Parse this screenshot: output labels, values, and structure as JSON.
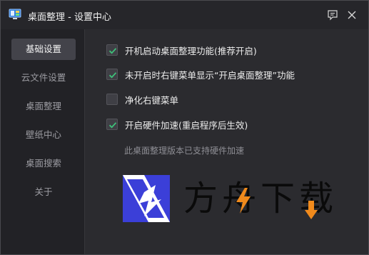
{
  "window": {
    "title": "桌面整理 - 设置中心",
    "icons": {
      "app": "monitor-icon",
      "feedback": "feedback-icon",
      "close": "close-icon"
    }
  },
  "sidebar": {
    "items": [
      {
        "label": "基础设置",
        "active": true
      },
      {
        "label": "云文件设置",
        "active": false
      },
      {
        "label": "桌面整理",
        "active": false
      },
      {
        "label": "壁纸中心",
        "active": false
      },
      {
        "label": "桌面搜索",
        "active": false
      },
      {
        "label": "关于",
        "active": false
      }
    ]
  },
  "settings": {
    "options": [
      {
        "label": "开机启动桌面整理功能(推荐开启)",
        "checked": true
      },
      {
        "label": "未开启时右键菜单显示“开启桌面整理”功能",
        "checked": true
      },
      {
        "label": "净化右键菜单",
        "checked": false
      },
      {
        "label": "开启硬件加速(重启程序后生效)",
        "checked": true
      }
    ],
    "hint": "此桌面整理版本已支持硬件加速"
  },
  "watermark": {
    "text": "方舟下载",
    "colors": {
      "text": "#0a0a0a",
      "accent": "#f08a1c",
      "mark_blue": "#3b3fd8"
    }
  },
  "colors": {
    "check": "#3ec27a",
    "window_bg": "#2b2b2f",
    "sidebar_bg": "#222226"
  }
}
